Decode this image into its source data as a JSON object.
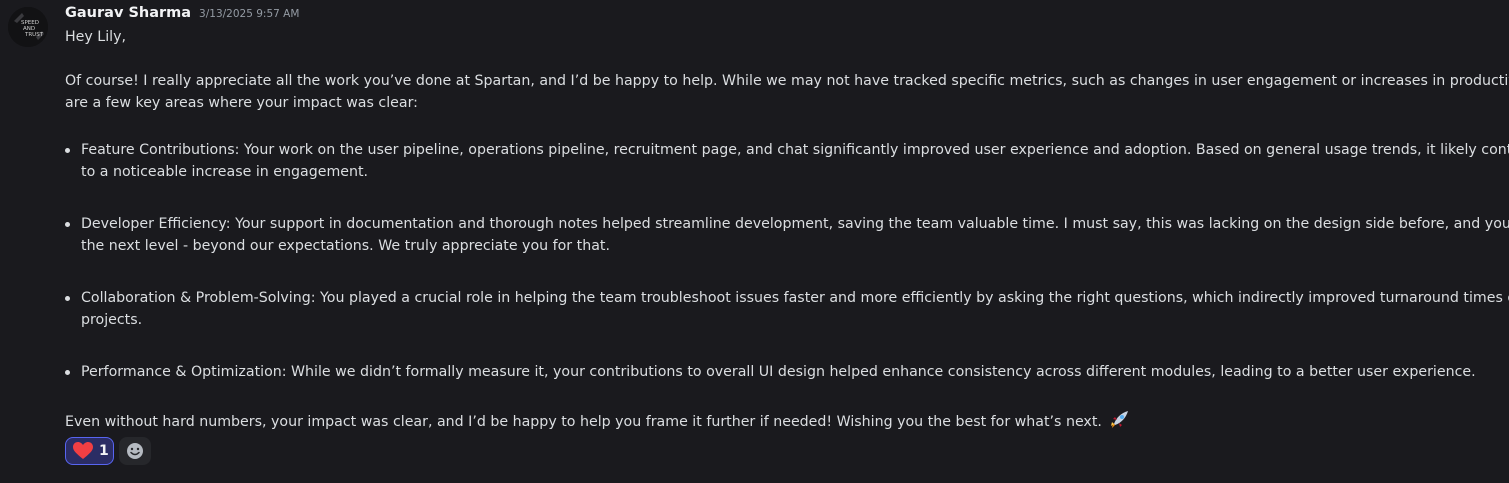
{
  "message": {
    "author": "Gaurav Sharma",
    "timestamp": "3/13/2025 9:57 AM",
    "avatar_text": [
      "SPEED",
      "AND",
      "TRUST"
    ],
    "greeting": "Hey Lily,",
    "intro": [
      "Of course! I really appreciate all the work you’ve done at Spartan, and I’d be happy to help. While we may not have tracked specific metrics, such as changes in user engagement or increases in productivity, here",
      "are a few key areas where your impact was clear:"
    ],
    "bullets": [
      {
        "lines": [
          "Feature Contributions: Your work on the user pipeline, operations pipeline, recruitment page, and chat significantly improved user experience and adoption. Based on general usage trends, it likely contributed",
          "to a noticeable increase in engagement."
        ]
      },
      {
        "lines": [
          "Developer Efficiency: Your support in documentation and thorough notes helped streamline development, saving the team valuable time. I must say, this was lacking on the design side before, and you took it to",
          "the next level - beyond our expectations. We truly appreciate you for that."
        ]
      },
      {
        "lines": [
          "Collaboration & Problem-Solving: You played a crucial role in helping the team troubleshoot issues faster and more efficiently by asking the right questions, which indirectly improved turnaround times on key",
          "projects."
        ]
      },
      {
        "lines": [
          "Performance & Optimization: While we didn’t formally measure it, your contributions to overall UI design helped enhance consistency across different modules, leading to a better user experience."
        ]
      }
    ],
    "closing": "Even without hard numbers, your impact was clear, and I’d be happy to help you frame it further if needed! Wishing you the best for what’s next.",
    "closing_emoji": "rocket-icon"
  },
  "reactions": [
    {
      "emoji": "heart-icon",
      "count": "1",
      "active": true
    }
  ],
  "add_reaction_icon": "add-reaction-icon",
  "colors": {
    "background": "#1a1a1e",
    "text": "#dbdee1",
    "author": "#f2f3f5",
    "timestamp": "#949ba4",
    "reaction_active_bg": "#2b2d64",
    "reaction_active_border": "#5865f2",
    "heart": "#f23f43"
  }
}
